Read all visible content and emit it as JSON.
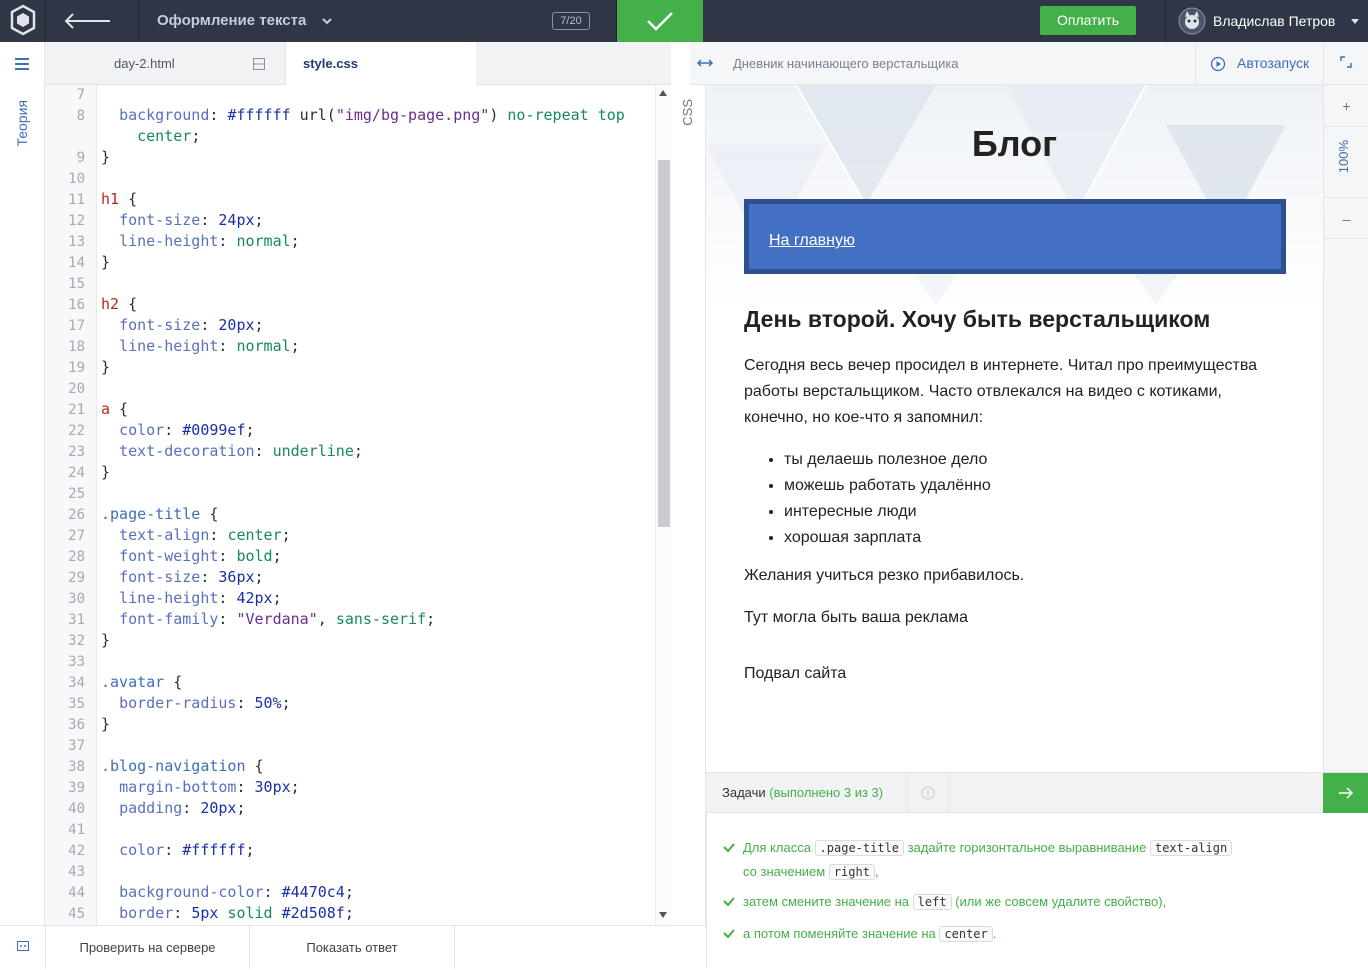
{
  "topbar": {
    "lesson_title": "Оформление текста",
    "progress": "7/20",
    "pay_label": "Оплатить",
    "user_name": "Владислав Петров",
    "colors": {
      "bar": "#2f3645",
      "accent": "#43b049"
    }
  },
  "rail": {
    "theory_label": "Теория"
  },
  "editor": {
    "tabs": [
      "day-2.html",
      "style.css"
    ],
    "active_tab": "style.css",
    "language": "CSS",
    "line_numbers": [
      "7",
      "8",
      "",
      "9",
      "10",
      "11",
      "12",
      "13",
      "14",
      "15",
      "16",
      "17",
      "18",
      "19",
      "20",
      "21",
      "22",
      "23",
      "24",
      "25",
      "26",
      "27",
      "28",
      "29",
      "30",
      "31",
      "32",
      "33",
      "34",
      "35",
      "36",
      "37",
      "38",
      "39",
      "40",
      "41",
      "42",
      "43",
      "44",
      "45"
    ],
    "code_lines": [
      "",
      "  background: #ffffff url(\"img/bg-page.png\") no-repeat top",
      "    center;",
      "}",
      "",
      "h1 {",
      "  font-size: 24px;",
      "  line-height: normal;",
      "}",
      "",
      "h2 {",
      "  font-size: 20px;",
      "  line-height: normal;",
      "}",
      "",
      "a {",
      "  color: #0099ef;",
      "  text-decoration: underline;",
      "}",
      "",
      ".page-title {",
      "  text-align: center;",
      "  font-weight: bold;",
      "  font-size: 36px;",
      "  line-height: 42px;",
      "  font-family: \"Verdana\", sans-serif;",
      "}",
      "",
      ".avatar {",
      "  border-radius: 50%;",
      "}",
      "",
      ".blog-navigation {",
      "  margin-bottom: 30px;",
      "  padding: 20px;",
      "",
      "  color: #ffffff;",
      "",
      "  background-color: #4470c4;",
      "  border: 5px solid #2d508f;"
    ],
    "check_label": "Проверить на сервере",
    "answer_label": "Показать ответ"
  },
  "preview": {
    "title": "Дневник начинающего верстальщика",
    "autorun_label": "Автозапуск",
    "zoom_level": "100%",
    "zoom_in": "+",
    "zoom_out": "–",
    "page": {
      "blog_title": "Блог",
      "nav_link": "На главную",
      "post_title": "День второй. Хочу быть верстальщиком",
      "post_text": "Сегодня весь вечер просидел в интернете. Читал про преимущества работы верстальщиком. Часто отвлекался на видео с котиками, конечно, но кое-что я запомнил:",
      "list": [
        "ты делаешь полезное дело",
        "можешь работать удалённо",
        "интересные люди",
        "хорошая зарплата"
      ],
      "p2": "Желания учиться резко прибавилось.",
      "ad": "Тут могла быть ваша реклама",
      "footer": "Подвал сайта",
      "nav_bg": "#4470c4",
      "nav_border": "#2d508f"
    }
  },
  "tasks": {
    "label": "Задачи",
    "count": "(выполнено 3 из 3)",
    "items": [
      {
        "a": "Для класса",
        "code1": ".page-title",
        "b": "задайте горизонтальное выравнивание",
        "code2": "text-align",
        "c": "со значением",
        "code3": "right",
        "d": ","
      },
      {
        "a": "затем смените значение на",
        "code1": "left",
        "b": "(или же совсем удалите свойство),"
      },
      {
        "a": "а потом поменяйте значение на",
        "code1": "center",
        "b": "."
      }
    ]
  }
}
